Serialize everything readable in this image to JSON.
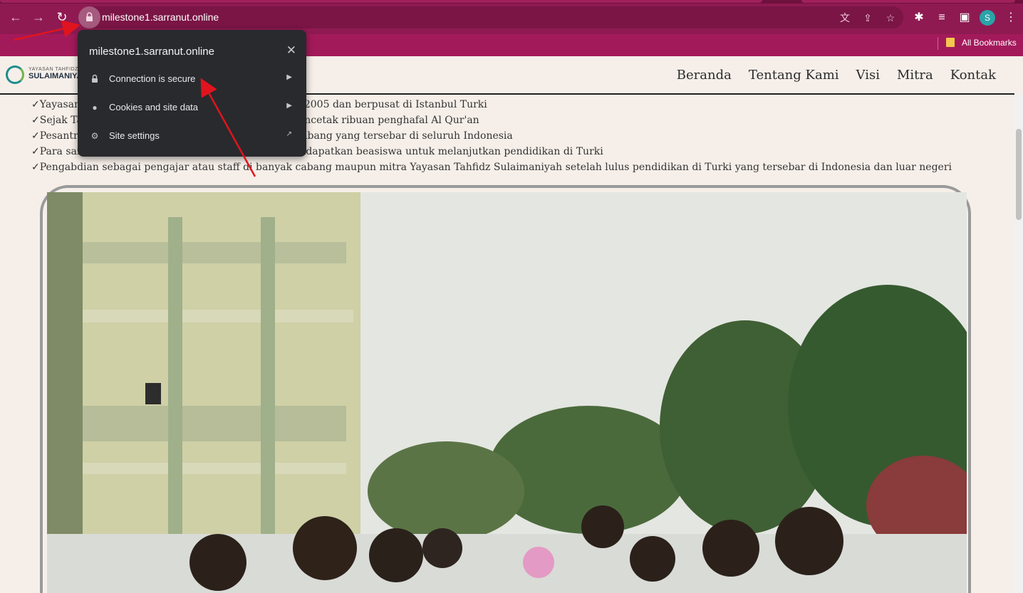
{
  "browser": {
    "url": "milestone1.sarranut.online",
    "profile_initial": "S",
    "bookmarks_label": "All Bookmarks",
    "icons": {
      "back": "arrow-left-icon",
      "forward": "arrow-right-icon",
      "reload": "reload-icon",
      "lock": "lock-icon",
      "translate": "translate-icon",
      "share": "share-icon",
      "star": "star-icon",
      "extensions": "puzzle-icon",
      "media": "media-queue-icon",
      "side_panel": "side-panel-icon",
      "menu": "kebab-menu-icon"
    },
    "theme_color": "#8f1a52"
  },
  "site_info_popup": {
    "title": "milestone1.sarranut.online",
    "items": [
      {
        "label": "Connection is secure",
        "icon": "lock-icon"
      },
      {
        "label": "Cookies and site data",
        "icon": "cookie-icon"
      },
      {
        "label": "Site settings",
        "icon": "gear-icon"
      }
    ]
  },
  "site": {
    "logo": {
      "small": "YAYASAN TAHFIDZ",
      "main": "SULAIMANIYAH"
    },
    "nav": [
      "Beranda",
      "Tentang Kami",
      "Visi",
      "Mitra",
      "Kontak"
    ],
    "bullets": [
      "✓Yayasan Tahfidz Sulaimaniyah didirikan pada tahun 2005 dan berpusat di Istanbul Turki",
      "✓Sejak Tahun 2005 Yayasan Tahfidz Sulaimaniyah mencetak ribuan penghafal Al Qur'an",
      "✓Pesantren Yayasan Tahfidz Sulaimaniyah memiliki cabang yang tersebar di seluruh Indonesia",
      "✓Para santri yang lulus hafalan Al Qur'an berhak mendapatkan beasiswa untuk melanjutkan pendidikan di Turki",
      "✓Pengabdian sebagai pengajar atau staff di banyak cabang maupun mitra Yayasan Tahfidz Sulaimaniyah setelah lulus pendidikan di Turki yang tersebar di Indonesia dan luar negeri"
    ],
    "accent_color": "#1e8d8d"
  }
}
